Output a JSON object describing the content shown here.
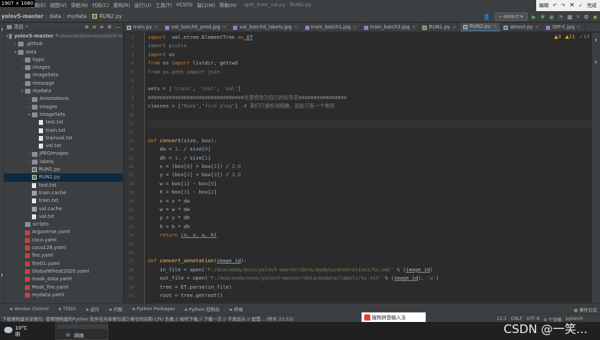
{
  "overlay": {
    "size_badge": "1907 × 1080"
  },
  "menu": {
    "items": [
      "编辑(E)",
      "视图(V)",
      "导航(N)",
      "代码(C)",
      "重构(R)",
      "运行(U)",
      "工具(T)",
      "VCS(S)",
      "窗口(W)",
      "帮助(H)"
    ]
  },
  "window_title": "split_train_val.py - RUN2.py",
  "edit_panel": {
    "label": "编辑",
    "done": "完成"
  },
  "breadcrumb": {
    "project": "yolov5-master",
    "parts": [
      "data",
      "mydata",
      "RUN2.py"
    ]
  },
  "toolbar": {
    "run_config": "detect"
  },
  "project_panel": {
    "title": "项目",
    "rows": [
      {
        "label": "yolov5-master",
        "extra": "F:\\Anaconda\\envs\\yolov5-m",
        "depth": 0,
        "arrow": "▾",
        "icon": "folder"
      },
      {
        "label": ".github",
        "depth": 1,
        "arrow": "›",
        "icon": "folder"
      },
      {
        "label": "data",
        "depth": 1,
        "arrow": "▾",
        "icon": "folder"
      },
      {
        "label": "hyps",
        "depth": 2,
        "arrow": "›",
        "icon": "folder"
      },
      {
        "label": "images",
        "depth": 2,
        "arrow": "›",
        "icon": "folder"
      },
      {
        "label": "ImageSets",
        "depth": 2,
        "arrow": "",
        "icon": "folder"
      },
      {
        "label": "message",
        "depth": 2,
        "arrow": "›",
        "icon": "folder"
      },
      {
        "label": "mydata",
        "depth": 2,
        "arrow": "▾",
        "icon": "folder"
      },
      {
        "label": "Annotations",
        "depth": 3,
        "arrow": "›",
        "icon": "folder"
      },
      {
        "label": "images",
        "depth": 3,
        "arrow": "›",
        "icon": "folder"
      },
      {
        "label": "ImageSets",
        "depth": 3,
        "arrow": "▾",
        "icon": "folder"
      },
      {
        "label": "test.txt",
        "depth": 4,
        "arrow": "",
        "icon": "file"
      },
      {
        "label": "train.txt",
        "depth": 4,
        "arrow": "",
        "icon": "file"
      },
      {
        "label": "trainval.txt",
        "depth": 4,
        "arrow": "",
        "icon": "file"
      },
      {
        "label": "val.txt",
        "depth": 4,
        "arrow": "",
        "icon": "file"
      },
      {
        "label": "JPEGImages",
        "depth": 3,
        "arrow": "›",
        "icon": "folder"
      },
      {
        "label": "labels",
        "depth": 3,
        "arrow": "›",
        "icon": "folder"
      },
      {
        "label": "RUN1.py",
        "depth": 3,
        "arrow": "",
        "icon": "py"
      },
      {
        "label": "RUN2.py",
        "depth": 3,
        "arrow": "",
        "icon": "py",
        "selected": true
      },
      {
        "label": "test.txt",
        "depth": 3,
        "arrow": "",
        "icon": "file"
      },
      {
        "label": "train.cache",
        "depth": 3,
        "arrow": "",
        "icon": "cache"
      },
      {
        "label": "train.txt",
        "depth": 3,
        "arrow": "",
        "icon": "file"
      },
      {
        "label": "val.cache",
        "depth": 3,
        "arrow": "",
        "icon": "cache"
      },
      {
        "label": "val.txt",
        "depth": 3,
        "arrow": "",
        "icon": "file"
      },
      {
        "label": "scripts",
        "depth": 2,
        "arrow": "›",
        "icon": "folder"
      },
      {
        "label": "Argoverse.yaml",
        "depth": 2,
        "arrow": "",
        "icon": "yaml"
      },
      {
        "label": "coco.yaml",
        "depth": 2,
        "arrow": "",
        "icon": "yaml"
      },
      {
        "label": "coco128.yaml",
        "depth": 2,
        "arrow": "",
        "icon": "yaml"
      },
      {
        "label": "fire.yaml",
        "depth": 2,
        "arrow": "",
        "icon": "yaml"
      },
      {
        "label": "fire01.yaml",
        "depth": 2,
        "arrow": "",
        "icon": "yaml"
      },
      {
        "label": "GlobalWheat2020.yaml",
        "depth": 2,
        "arrow": "",
        "icon": "yaml"
      },
      {
        "label": "mask_data.yaml",
        "depth": 2,
        "arrow": "",
        "icon": "yaml"
      },
      {
        "label": "Mask_fire.yaml",
        "depth": 2,
        "arrow": "",
        "icon": "yaml"
      },
      {
        "label": "mydata.yaml",
        "depth": 2,
        "arrow": "",
        "icon": "yaml"
      }
    ]
  },
  "tabs": [
    {
      "label": "train.py",
      "kind": "py"
    },
    {
      "label": "val_batch0_pred.jpg",
      "kind": "img"
    },
    {
      "label": "val_batch0_labels.jpg",
      "kind": "img"
    },
    {
      "label": "train_batch1.jpg",
      "kind": "img"
    },
    {
      "label": "train_batch2.jpg",
      "kind": "img"
    },
    {
      "label": "RUN1.py",
      "kind": "py"
    },
    {
      "label": "RUN2.py",
      "kind": "py",
      "active": true
    },
    {
      "label": "detect.py",
      "kind": "py"
    },
    {
      "label": "OIP-C.jpg",
      "kind": "img"
    }
  ],
  "inspections": {
    "warnings": "▲3",
    "weak": "▲11",
    "ok": "✓13"
  },
  "code": [
    {
      "n": "1",
      "t": [
        [
          "kw",
          "import"
        ],
        [
          "",
          "  xml.etree.ElementTree "
        ],
        [
          "kw",
          "as"
        ],
        [
          "under",
          " ET"
        ]
      ]
    },
    {
      "n": "2",
      "t": [
        [
          "gray",
          "import pickle"
        ]
      ]
    },
    {
      "n": "3",
      "t": [
        [
          "kw",
          "import"
        ],
        [
          "",
          " os"
        ]
      ]
    },
    {
      "n": "4",
      "t": [
        [
          "kw",
          "from"
        ],
        [
          "",
          " os "
        ],
        [
          "kw",
          "import"
        ],
        [
          "",
          " listdir, getcwd"
        ]
      ]
    },
    {
      "n": "5",
      "t": [
        [
          "gray",
          "from os.path import join"
        ]
      ]
    },
    {
      "n": "6",
      "t": []
    },
    {
      "n": "7",
      "t": [
        [
          "",
          "sets = ["
        ],
        [
          "str",
          "'train'"
        ],
        [
          "",
          ", "
        ],
        [
          "str",
          "'test'"
        ],
        [
          "",
          ", "
        ],
        [
          "str",
          "'val'"
        ],
        [
          "",
          "]"
        ]
      ]
    },
    {
      "n": "8",
      "t": [
        [
          "cm",
          "################################这里修改为自己的标签名################"
        ]
      ]
    },
    {
      "n": "9",
      "t": [
        [
          "",
          "classes = ["
        ],
        [
          "str",
          "\"Mask\""
        ],
        [
          "",
          ","
        ],
        [
          "str",
          "\"fire plug\""
        ],
        [
          "",
          "]  "
        ],
        [
          "cm",
          "# 我们只是检测细胞，因此只有一个类别"
        ]
      ]
    },
    {
      "n": "10",
      "t": []
    },
    {
      "n": "11",
      "t": [],
      "current": true
    },
    {
      "n": "12",
      "t": []
    },
    {
      "n": "13",
      "t": [
        [
          "kw",
          "def"
        ],
        [
          "",
          " "
        ],
        [
          "fn",
          "convert"
        ],
        [
          "",
          "(size, box):"
        ]
      ]
    },
    {
      "n": "14",
      "t": [
        [
          "",
          "    dw = "
        ],
        [
          "num",
          "1."
        ],
        [
          "",
          " / size["
        ],
        [
          "num",
          "0"
        ],
        [
          "",
          "]"
        ]
      ]
    },
    {
      "n": "15",
      "t": [
        [
          "",
          "    dh = "
        ],
        [
          "num",
          "1."
        ],
        [
          "",
          " / size["
        ],
        [
          "num",
          "1"
        ],
        [
          "",
          "]"
        ]
      ]
    },
    {
      "n": "16",
      "t": [
        [
          "",
          "    x = (box["
        ],
        [
          "num",
          "0"
        ],
        [
          "",
          "] + box["
        ],
        [
          "num",
          "1"
        ],
        [
          "",
          "]) / "
        ],
        [
          "num",
          "2.0"
        ]
      ]
    },
    {
      "n": "17",
      "t": [
        [
          "",
          "    y = (box["
        ],
        [
          "num",
          "2"
        ],
        [
          "",
          "] + box["
        ],
        [
          "num",
          "3"
        ],
        [
          "",
          "]) / "
        ],
        [
          "num",
          "2.0"
        ]
      ]
    },
    {
      "n": "18",
      "t": [
        [
          "",
          "    w = box["
        ],
        [
          "num",
          "1"
        ],
        [
          "",
          "] - box["
        ],
        [
          "num",
          "0"
        ],
        [
          "",
          "]"
        ]
      ]
    },
    {
      "n": "19",
      "t": [
        [
          "",
          "    h = box["
        ],
        [
          "num",
          "3"
        ],
        [
          "",
          "] - box["
        ],
        [
          "num",
          "2"
        ],
        [
          "",
          "]"
        ]
      ]
    },
    {
      "n": "20",
      "t": [
        [
          "",
          "    x = x * dw"
        ]
      ]
    },
    {
      "n": "21",
      "t": [
        [
          "",
          "    w = w * dw"
        ]
      ]
    },
    {
      "n": "22",
      "t": [
        [
          "",
          "    y = y * dh"
        ]
      ]
    },
    {
      "n": "23",
      "t": [
        [
          "",
          "    h = h * dh"
        ]
      ]
    },
    {
      "n": "24",
      "t": [
        [
          "kw",
          "    return"
        ],
        [
          "",
          " "
        ],
        [
          "under",
          "(x, y, w, h)"
        ]
      ]
    },
    {
      "n": "25",
      "t": []
    },
    {
      "n": "26",
      "t": []
    },
    {
      "n": "27",
      "t": [
        [
          "kw",
          "def"
        ],
        [
          "",
          " "
        ],
        [
          "fn",
          "convert_annotation"
        ],
        [
          "",
          "("
        ],
        [
          "under",
          "image_id"
        ],
        [
          "",
          "):"
        ]
      ]
    },
    {
      "n": "28",
      "t": [
        [
          "",
          "    in_file = open("
        ],
        [
          "str",
          "'F:/Anaconda/envs/yolov5-master/data/mydata/Annotations/%s.xml'"
        ],
        [
          "",
          " % ("
        ],
        [
          "under",
          "image_id"
        ],
        [
          "",
          ")"
        ]
      ]
    },
    {
      "n": "29",
      "t": [
        [
          "",
          "    out_file = open("
        ],
        [
          "str",
          "'F:/Anaconda/envs/yolov5-master/data/mydata/labels/%s.txt'"
        ],
        [
          "",
          " % ("
        ],
        [
          "under",
          "image_id"
        ],
        [
          "",
          "), "
        ],
        [
          "str",
          "'w'"
        ],
        [
          "",
          ")"
        ]
      ]
    },
    {
      "n": "30",
      "t": [
        [
          "",
          "    tree = ET.parse(in_file)"
        ]
      ]
    },
    {
      "n": "31",
      "t": [
        [
          "",
          "    root = tree.getroot()"
        ]
      ]
    }
  ],
  "tool_windows": [
    "Version Control",
    "TODO",
    "运行",
    "问题",
    "Python Packages",
    "Python 控制台",
    "终端"
  ],
  "event_log": "事件日志",
  "status": {
    "message": "下载预构建共享索引: 使用预构建的Python 软件包共享索引减少索引时间和 CPU 负载 // 始终下载 // 下载一次 // 不再显示 // 配置... (昨天 22:53)",
    "position": "11:1",
    "line_sep": "CRLF",
    "encoding": "UTF-8",
    "indent": "4 个空格",
    "interpreter": "pytorch"
  },
  "ime": {
    "label": "搜狗拼音输入法"
  },
  "taskbar": {
    "temp": "10°C",
    "weather": "阴",
    "thumb_label": "网络"
  },
  "watermark": "CSDN @一笑..."
}
